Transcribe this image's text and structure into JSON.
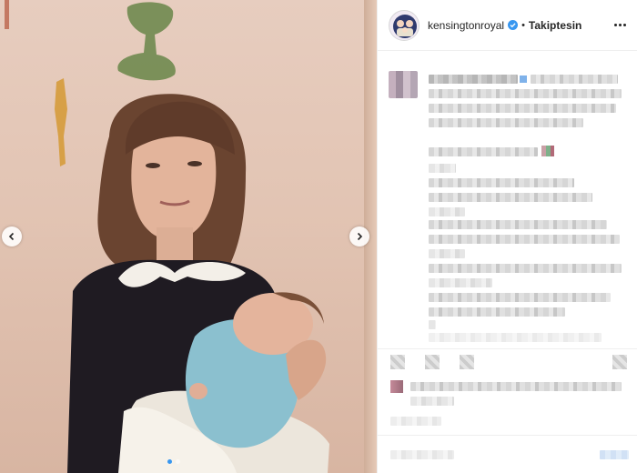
{
  "post": {
    "username": "kensingtonroyal",
    "separator": "•",
    "follow_status": "Takiptesin"
  },
  "icons": {
    "verified": "verified-badge-icon",
    "more": "more-options-icon",
    "prev": "chevron-left-icon",
    "next": "chevron-right-icon"
  },
  "colors": {
    "verified_blue": "#3897f0",
    "text": "#262626",
    "divider": "#efefef"
  },
  "carousel": {
    "total_slides": 2,
    "active_slide": 1
  }
}
